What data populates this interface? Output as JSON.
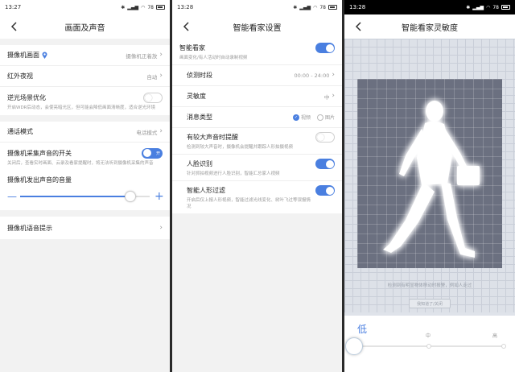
{
  "colors": {
    "accent": "#4a7fe0",
    "muted": "#999999"
  },
  "screen1": {
    "status": {
      "time": "13:27",
      "battery": "78"
    },
    "title": "画面及声音",
    "camera_view": {
      "label": "摄像机画面",
      "value": "摄像机正着放"
    },
    "night_vision": {
      "label": "红外夜视",
      "value": "自动"
    },
    "backlight": {
      "label": "逆光场景优化",
      "desc": "开启WDR后动态，会使亮暗光区，但可能会降低画面清晰度，适合逆光环境",
      "on": false
    },
    "call_mode": {
      "label": "通话模式",
      "value": "电话模式"
    },
    "sound_capture": {
      "label": "摄像机采集声音的开关",
      "desc": "关闭后，查看实时画面、云录及看家提醒时，将无法听到摄像机采集的声音",
      "on": true,
      "on_text": "开"
    },
    "volume": {
      "label": "摄像机发出声音的音量",
      "level": 0.85,
      "minus": "—",
      "plus": "+"
    },
    "voice_prompt": {
      "label": "摄像机语音提示"
    }
  },
  "screen2": {
    "status": {
      "time": "13:28",
      "battery": "78"
    },
    "title": "智能看家设置",
    "smart_guard": {
      "label": "智能看家",
      "desc": "画面变化/有人活动时自动录制视频",
      "on": true
    },
    "period": {
      "label": "侦测时段",
      "value": "00:00 - 24:00"
    },
    "sensitivity": {
      "label": "灵敏度",
      "value": "中"
    },
    "msg_type": {
      "label": "消息类型",
      "opt1": "视频",
      "opt2": "图片"
    },
    "loud_sound": {
      "label": "有较大声音时提醒",
      "desc": "检测到较大声音时，摄像机会提醒并跟踪人形拍摄视频",
      "on": false
    },
    "face": {
      "label": "人脸识别",
      "desc": "针对抓拍视频进行人脸识别，智能汇总家人视频",
      "on": true
    },
    "human_filter": {
      "label": "智能人形过滤",
      "desc": "开启后仅上报人形视频，智能过滤光线变化、树叶飞过等误报情况",
      "on": true
    }
  },
  "screen3": {
    "status": {
      "time": "13:28",
      "battery": "78"
    },
    "title": "智能看家灵敏度",
    "hint": "检测到有明显物体移动时报警，例如人走过",
    "button": "我知道了/关闭",
    "levels": {
      "low": "低",
      "mid": "中",
      "high": "高"
    },
    "selected": 0
  }
}
